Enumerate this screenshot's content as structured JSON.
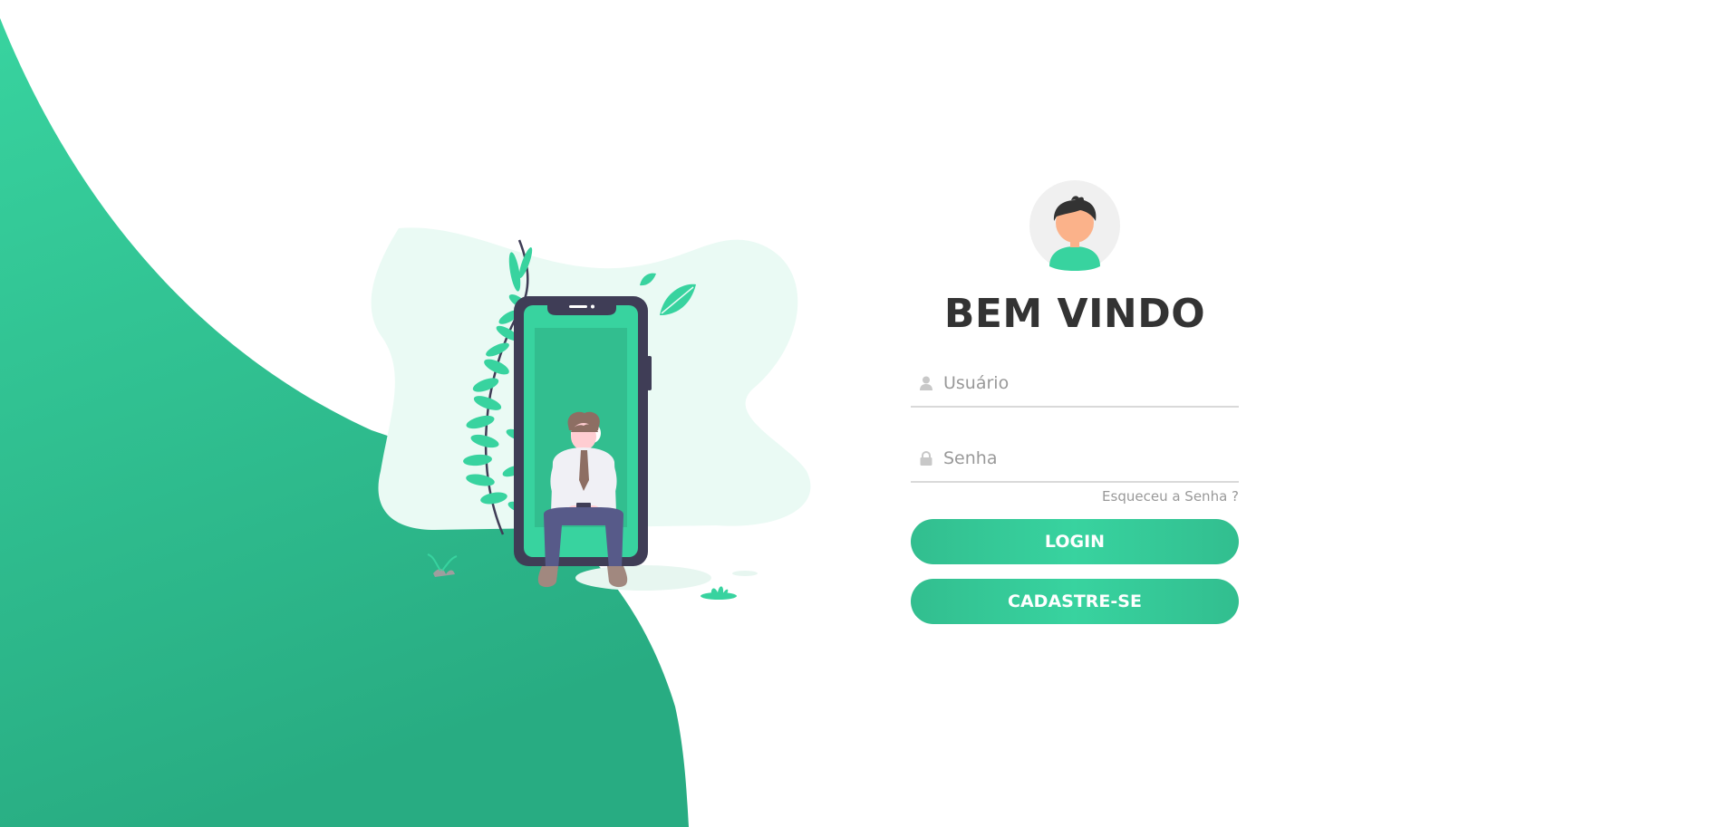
{
  "brand": {
    "accent": "#38d39f",
    "accent_dark": "#32be8f",
    "text_dark": "#333333",
    "muted": "#999999"
  },
  "login": {
    "title": "BEM VINDO",
    "username_placeholder": "Usuário",
    "password_placeholder": "Senha",
    "forgot_label": "Esqueceu a Senha ?",
    "login_button": "LOGIN",
    "register_button": "CADASTRE-SE",
    "username_icon": "user-icon",
    "password_icon": "lock-icon"
  }
}
